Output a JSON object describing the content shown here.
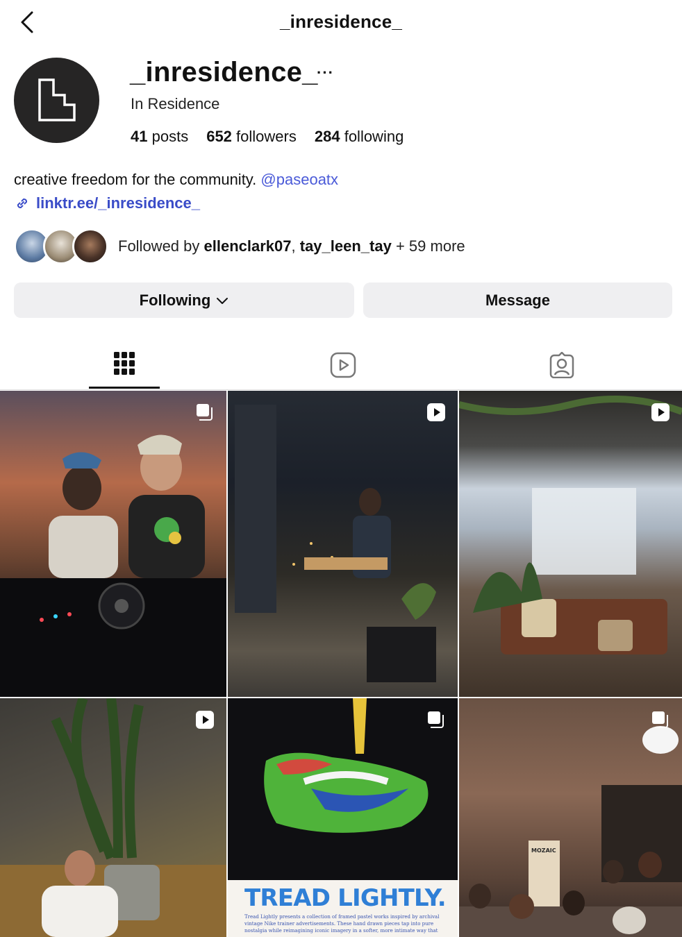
{
  "header": {
    "title": "_inresidence_",
    "back_icon": "chevron-left-icon"
  },
  "profile": {
    "username": "_inresidence_",
    "more_label": "···",
    "display_name": "In Residence",
    "stats": [
      {
        "count": "41",
        "label": "posts"
      },
      {
        "count": "652",
        "label": "followers"
      },
      {
        "count": "284",
        "label": "following"
      }
    ],
    "bio": "creative freedom for the community.",
    "bio_mention": "@paseoatx",
    "link": "linktr.ee/_inresidence_",
    "followed_by": {
      "prefix": "Followed by",
      "user1": "ellenclark07",
      "separator": ",",
      "user2": "tay_leen_tay",
      "suffix": "+ 59 more"
    }
  },
  "actions": {
    "following_label": "Following",
    "message_label": "Message"
  },
  "tabs": [
    {
      "name": "posts",
      "icon": "grid-icon",
      "active": true
    },
    {
      "name": "reels",
      "icon": "reels-icon",
      "active": false
    },
    {
      "name": "tagged",
      "icon": "tagged-icon",
      "active": false
    }
  ],
  "posts": [
    {
      "badge": "carousel-icon",
      "subject": "two DJs at turntables at sunset"
    },
    {
      "badge": "reel-icon",
      "subject": "keyboard player by night window"
    },
    {
      "badge": "reel-icon",
      "subject": "lounge with projector screen"
    },
    {
      "badge": "reel-icon",
      "subject": "man writing by plant"
    },
    {
      "badge": "carousel-icon",
      "subject": "pastel sneaker artwork",
      "title": "TREAD LIGHTLY.",
      "caption": "Tread Lightly presents a collection of framed pastel works inspired by archival vintage Nike trainer advertisements. These hand drawn pieces tap into pure nostalgia while reimagining iconic imagery in a softer, more intimate way that"
    },
    {
      "badge": "carousel-icon",
      "subject": "people crafting at tables",
      "sign_text": "MOZAIC"
    }
  ],
  "colors": {
    "accent_link": "#3a4cc8",
    "button_bg": "#efeff1",
    "avatar_bg": "#262525"
  }
}
